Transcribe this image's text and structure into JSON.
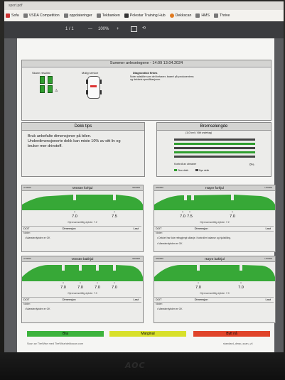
{
  "browser": {
    "tab_title": "sport.pdf",
    "bookmarks": [
      {
        "label": "Sofa",
        "icon": "page-icon"
      },
      {
        "label": "VSDA Competition",
        "icon": "page-icon"
      },
      {
        "label": "oppdateringer",
        "icon": "page-icon"
      },
      {
        "label": "Tekbanken",
        "icon": "page-icon"
      },
      {
        "label": "Polestar Training Hub",
        "icon": "page-icon"
      },
      {
        "label": "Dekkscan",
        "icon": "page-icon"
      },
      {
        "label": "HMS",
        "icon": "page-icon"
      },
      {
        "label": "Thrive",
        "icon": "page-icon"
      }
    ]
  },
  "pdf_toolbar": {
    "page_indicator": "1 / 1",
    "zoom_out": "—",
    "zoom": "100%",
    "zoom_in": "+"
  },
  "report": {
    "title": "Summer avlesningene - 14:09 13.04.2024",
    "scan_result_label": "Skann resultat",
    "service_label": "Mulig service",
    "diagnostic_label": "Diagnostisk fintes",
    "diagnostic_note": "Noter adskilte som det behøver, basert på produsentens og dekkets spesifikasjoner.",
    "tips_title": "Dekk tips",
    "tips_text": "Bruk anbefalte dimensjoner på bilen. Underdimensjonerte dekk kan miste 10% av sitt liv og bruker mer drivstoff.",
    "brake_title": "Bremselengde",
    "brake_subtitle": "(110 km/t, Vått underlag)",
    "brake_control_label": "Kontroll av utmaner",
    "brake_control_value": "0%",
    "legend_good": "Dine dekk",
    "legend_new": "Nye dekk",
    "tires": [
      {
        "position": "Venstre forhjul",
        "code_left": "UT0000",
        "code_right": "SN0000",
        "depths": [
          "7.0",
          "7.5"
        ],
        "groove_label": "Gjennomsnittlig dybde: 7.2",
        "dot": "DOT",
        "dimension": "Dimensjon",
        "load": "Last",
        "notes": "Noter:",
        "bullets": [
          "Mønsterdybden er OK"
        ]
      },
      {
        "position": "Høyre forhjul",
        "code_left": "SN0000",
        "code_right": "UT0000",
        "depths": [
          "7.0",
          "7.5",
          "7.0"
        ],
        "groove_label": "Gjennomsnittlig dybde: 7.2",
        "dot": "DOT",
        "dimension": "Dimensjon",
        "load": "Last",
        "notes": "Noter:",
        "bullets": [
          "Dekket har ikke rettsgjengt slitasje. Kontroller balanse og hjulstilling.",
          "Mønsterdybden er OK"
        ]
      },
      {
        "position": "Venstre bakhjul",
        "code_left": "UT0000",
        "code_right": "SN0000",
        "depths": [
          "7.0",
          "7.0",
          "7.0",
          "7.0"
        ],
        "groove_label": "Gjennomsnittlig dybde: 7.0",
        "dot": "DOT",
        "dimension": "Dimensjon",
        "load": "Last",
        "notes": "Noter:",
        "bullets": [
          "Mønsterdybden er OK"
        ]
      },
      {
        "position": "Høyre bakhjul",
        "code_left": "SN0000",
        "code_right": "UT0000",
        "depths": [
          "7.0",
          "7.0"
        ],
        "groove_label": "Gjennomsnittlig dybde: 7.0",
        "dot": "DOT",
        "dimension": "Dimensjon",
        "load": "Last",
        "notes": "Noter:",
        "bullets": [
          "Mønsterdybden er OK"
        ]
      }
    ],
    "status": [
      {
        "label": "Bra",
        "color": "#3db33d"
      },
      {
        "label": "Marginal",
        "color": "#d8e02a"
      },
      {
        "label": "Bytt nå",
        "color": "#e0442a"
      }
    ],
    "footer_left": "Scan av TireWise med TireWise/dekkscan.com",
    "footer_right": "standard_deep_scan_v4"
  },
  "monitor": {
    "brand": "AOC"
  },
  "colors": {
    "tread_green": "#37a837",
    "brake_dark": "#444444",
    "brake_green": "#2f9e2f"
  }
}
